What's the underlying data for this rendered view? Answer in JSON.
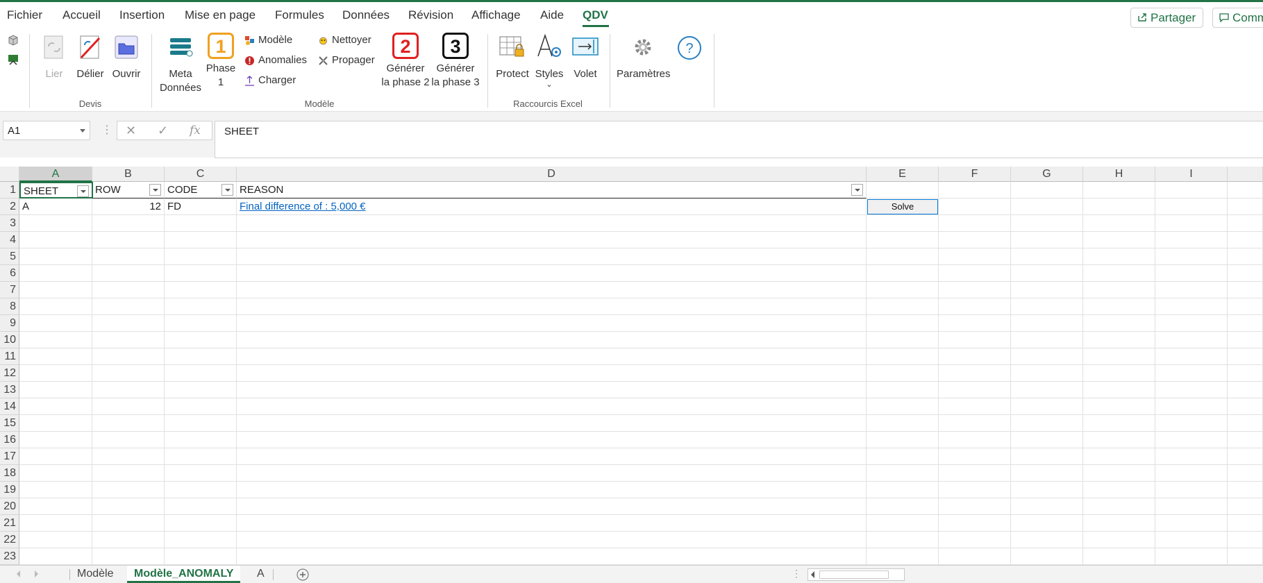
{
  "menu": {
    "tabs": [
      "Fichier",
      "Accueil",
      "Insertion",
      "Mise en page",
      "Formules",
      "Données",
      "Révision",
      "Affichage",
      "Aide",
      "QDV"
    ],
    "active": "QDV",
    "share_label": "Partager",
    "comments_label": "Comm"
  },
  "ribbon": {
    "devis": {
      "label": "Devis",
      "lier": "Lier",
      "delier": "Délier",
      "ouvrir": "Ouvrir"
    },
    "modele": {
      "label": "Modèle",
      "meta_line1": "Meta",
      "meta_line2": "Données",
      "phase_line1": "Phase",
      "phase_line2": "1",
      "phase_num": "1",
      "modele": "Modèle",
      "anomalies": "Anomalies",
      "charger": "Charger",
      "nettoyer": "Nettoyer",
      "propager": "Propager",
      "gen2_line1": "Générer",
      "gen2_line2": "la phase 2",
      "gen2_num": "2",
      "gen3_line1": "Générer",
      "gen3_line2": "la phase 3",
      "gen3_num": "3"
    },
    "raccourcis": {
      "label": "Raccourcis Excel",
      "protect": "Protect",
      "styles": "Styles",
      "volet": "Volet"
    },
    "parametres": "Paramètres"
  },
  "formula_bar": {
    "name_box": "A1",
    "fx": "fx",
    "content": "SHEET"
  },
  "grid": {
    "columns": [
      "A",
      "B",
      "C",
      "D",
      "E",
      "F",
      "G",
      "H",
      "I"
    ],
    "selected_column": "A",
    "rows": [
      "1",
      "2",
      "3",
      "4",
      "5",
      "6",
      "7",
      "8",
      "9",
      "10",
      "11",
      "12",
      "13",
      "14",
      "15",
      "16",
      "17",
      "18",
      "19",
      "20",
      "21",
      "22",
      "23"
    ],
    "header": {
      "sheet": "SHEET",
      "row": "ROW",
      "code": "CODE",
      "reason": "REASON"
    },
    "data": {
      "sheet": "A",
      "row": "12",
      "code": "FD",
      "reason": "Final difference of : 5,000 €"
    },
    "solve_label": "Solve"
  },
  "sheets": {
    "tabs": [
      "Modèle",
      "Modèle_ANOMALY",
      "A"
    ],
    "active": "Modèle_ANOMALY"
  },
  "colors": {
    "accent": "#217346",
    "link": "#0563c1",
    "gen2_border": "#e02020",
    "phase1_border": "#f0a020"
  }
}
